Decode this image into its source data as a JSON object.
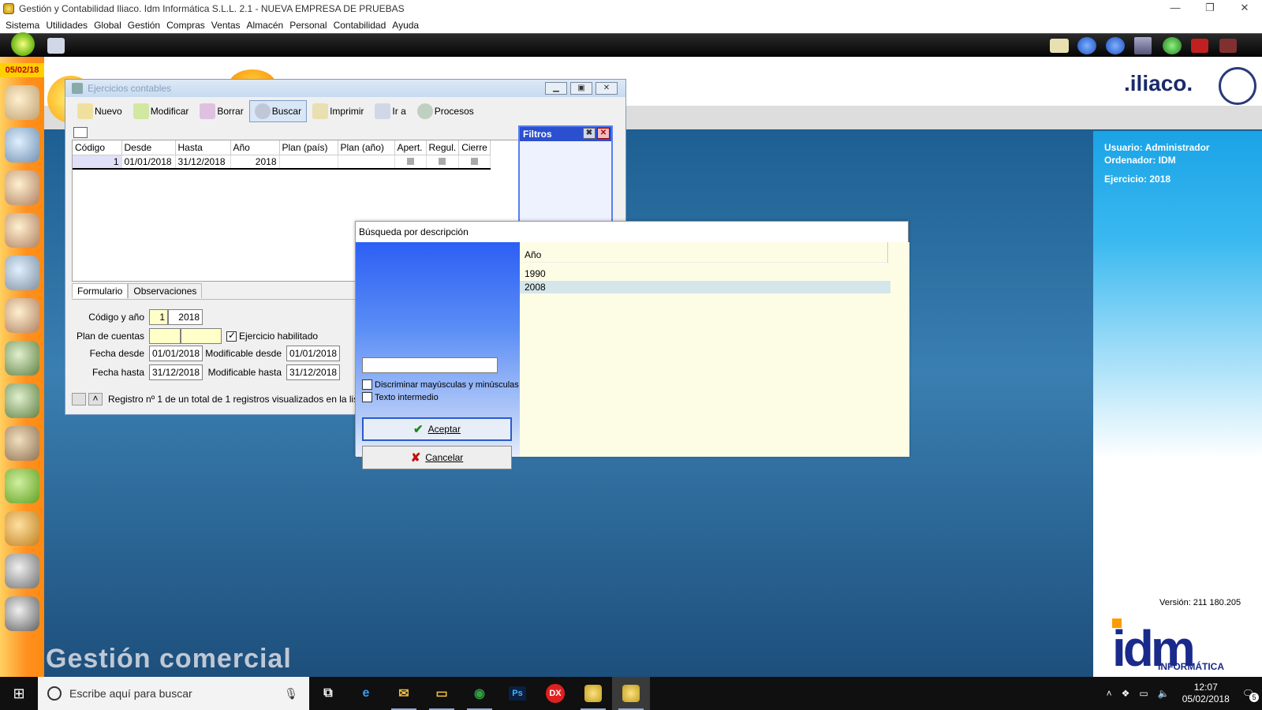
{
  "titlebar": {
    "title": "Gestión y Contabilidad Iliaco. Idm Informática S.L.L. 2.1 - NUEVA EMPRESA DE PRUEBAS"
  },
  "menubar": {
    "items": [
      "Sistema",
      "Utilidades",
      "Global",
      "Gestión",
      "Compras",
      "Ventas",
      "Almacén",
      "Personal",
      "Contabilidad",
      "Ayuda"
    ]
  },
  "sidebar": {
    "date": "05/02/18"
  },
  "branding": {
    "iliaco": ".iliaco.",
    "app_name": "Gestión comercial",
    "idm": "idm",
    "idm_sub": "INFORMÁTICA",
    "version": "Versión: 211 180.205"
  },
  "user_panel": {
    "usuario": "Usuario: Administrador",
    "ordenador": "Ordenador: IDM",
    "ejercicio": "Ejercicio: 2018"
  },
  "window": {
    "title": "Ejercicios contables",
    "tools": [
      "Nuevo",
      "Modificar",
      "Borrar",
      "Buscar",
      "Imprimir",
      "Ir a",
      "Procesos"
    ],
    "grid": {
      "columns": [
        "Código",
        "Desde",
        "Hasta",
        "Año",
        "Plan (país)",
        "Plan (año)",
        "Apert.",
        "Regul.",
        "Cierre"
      ],
      "rows": [
        [
          "1",
          "01/01/2018",
          "31/12/2018",
          "2018",
          "",
          "",
          "",
          "",
          ""
        ]
      ]
    },
    "filtros_title": "Filtros",
    "tabs": [
      "Formulario",
      "Observaciones"
    ],
    "form": {
      "codigo_label": "Código y año",
      "codigo": "1",
      "anio": "2018",
      "plan_label": "Plan de cuentas",
      "ejercicio_habilitado": "Ejercicio habilitado",
      "fecha_desde_label": "Fecha desde",
      "fecha_desde": "01/01/2018",
      "fecha_hasta_label": "Fecha hasta",
      "fecha_hasta": "31/12/2018",
      "mod_desde_label": "Modificable desde",
      "mod_desde": "01/01/2018",
      "mod_hasta_label": "Modificable hasta",
      "mod_hasta": "31/12/2018"
    },
    "status": "Registro nº 1 de un total de 1 registros visualizados en la lista."
  },
  "dialog": {
    "title": "Búsqueda por descripción",
    "search_value": "",
    "chk_case": "Discriminar mayúsculas y minúsculas",
    "chk_middle": "Texto intermedio",
    "accept": "Aceptar",
    "cancel": "Cancelar",
    "list_header": "Año",
    "list_items": [
      "1990",
      "2008"
    ],
    "selected_index": 1
  },
  "taskbar": {
    "search_placeholder": "Escribe aquí para buscar",
    "time": "12:07",
    "date": "05/02/2018",
    "notifications": "5",
    "apps": [
      "task-view",
      "edge",
      "mail",
      "explorer",
      "chrome",
      "photoshop",
      "dx",
      "iliaco-1",
      "iliaco-2"
    ]
  }
}
